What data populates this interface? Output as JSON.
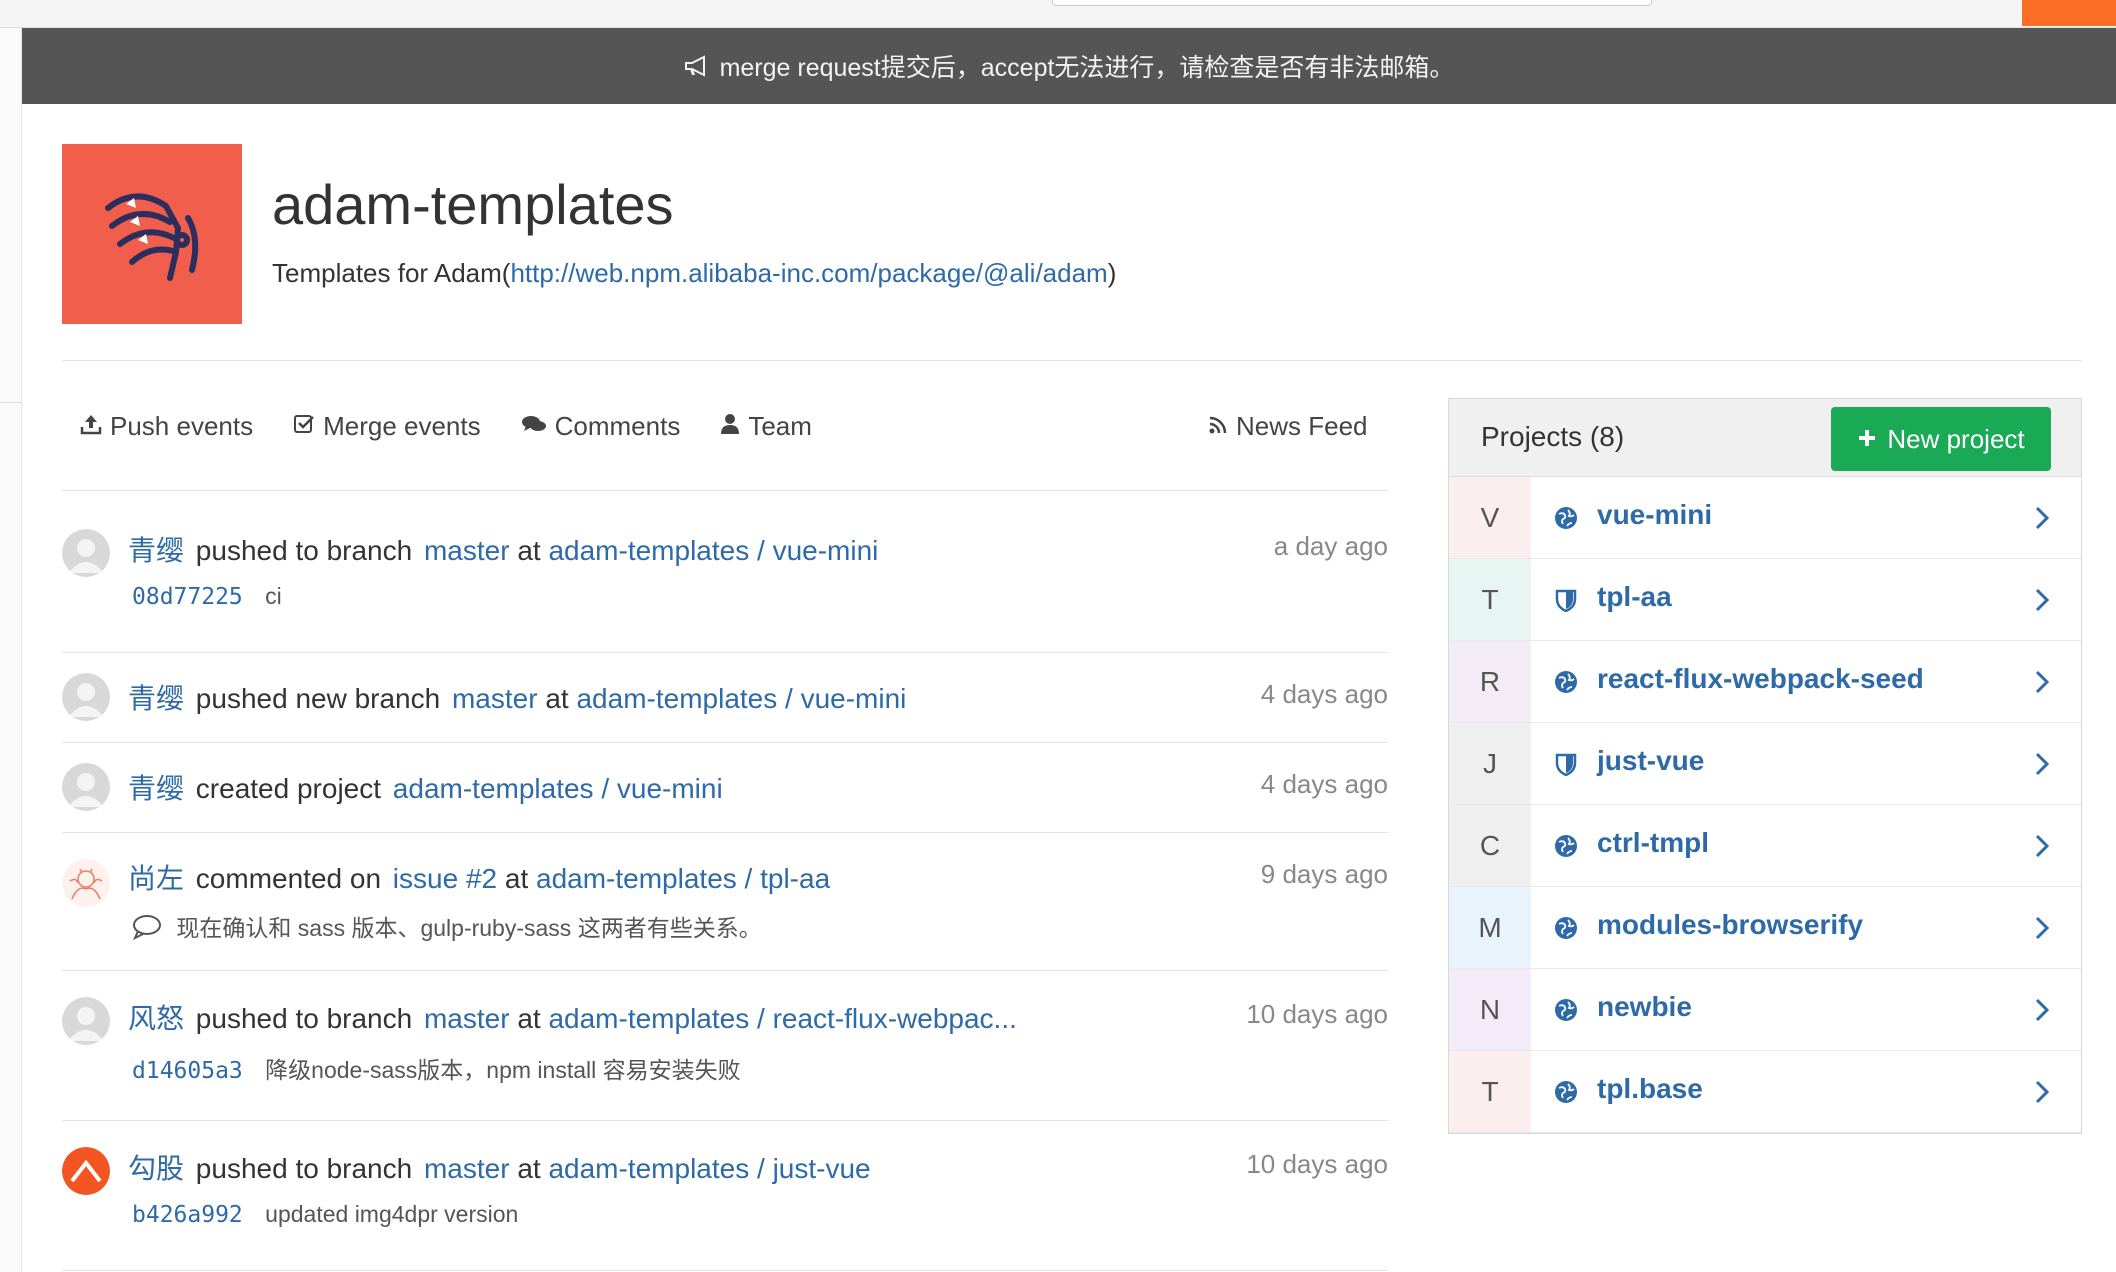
{
  "broadcast": {
    "icon": "bullhorn-icon",
    "text": "merge request提交后，accept无法进行，请检查是否有非法邮箱。"
  },
  "group": {
    "title": "adam-templates",
    "description_prefix": "Templates for Adam(",
    "description_link": "http://web.npm.alibaba-inc.com/package/@ali/adam",
    "description_suffix": ")",
    "avatar_color": "#f25e4c"
  },
  "filters": [
    {
      "label": "Push events",
      "icon": "upload-icon"
    },
    {
      "label": "Merge events",
      "icon": "check-square-icon"
    },
    {
      "label": "Comments",
      "icon": "comments-icon"
    },
    {
      "label": "Team",
      "icon": "user-icon"
    }
  ],
  "news_feed": {
    "label": "News Feed",
    "icon": "rss-icon"
  },
  "events": [
    {
      "author": "青缨",
      "action": "pushed to branch",
      "ref": "master",
      "at": "at",
      "project": "adam-templates / vue-mini",
      "time": "a day ago",
      "sha": "08d77225",
      "message": "ci"
    },
    {
      "author": "青缨",
      "action": "pushed new branch",
      "ref": "master",
      "at": "at",
      "project": "adam-templates / vue-mini",
      "time": "4 days ago"
    },
    {
      "author": "青缨",
      "action": "created project",
      "project": "adam-templates / vue-mini",
      "time": "4 days ago"
    },
    {
      "author": "尚左",
      "action": "commented on",
      "ref": "issue #2",
      "at": "at",
      "project": "adam-templates / tpl-aa",
      "time": "9 days ago",
      "comment": "现在确认和 sass 版本、gulp-ruby-sass 这两者有些关系。"
    },
    {
      "author": "风怒",
      "action": "pushed to branch",
      "ref": "master",
      "at": "at",
      "project": "adam-templates / react-flux-webpac...",
      "time": "10 days ago",
      "sha": "d14605a3",
      "message": "降级node-sass版本，npm install 容易安装失败"
    },
    {
      "author": "勾股",
      "action": "pushed to branch",
      "ref": "master",
      "at": "at",
      "project": "adam-templates / just-vue",
      "time": "10 days ago",
      "sha": "b426a992",
      "message": "updated img4dpr version"
    }
  ],
  "projects": {
    "title": "Projects (8)",
    "new_button": "New project",
    "items": [
      {
        "letter": "V",
        "name": "vue-mini",
        "visibility": "globe-icon",
        "bg": "#fbeeee"
      },
      {
        "letter": "T",
        "name": "tpl-aa",
        "visibility": "shield-icon",
        "bg": "#e8f6f3"
      },
      {
        "letter": "R",
        "name": "react-flux-webpack-seed",
        "visibility": "globe-icon",
        "bg": "#f3ecf7"
      },
      {
        "letter": "J",
        "name": "just-vue",
        "visibility": "shield-icon",
        "bg": "#efefef"
      },
      {
        "letter": "C",
        "name": "ctrl-tmpl",
        "visibility": "globe-icon",
        "bg": "#efefef"
      },
      {
        "letter": "M",
        "name": "modules-browserify",
        "visibility": "globe-icon",
        "bg": "#e9f3fb"
      },
      {
        "letter": "N",
        "name": "newbie",
        "visibility": "globe-icon",
        "bg": "#f3ecf8"
      },
      {
        "letter": "T",
        "name": "tpl.base",
        "visibility": "globe-icon",
        "bg": "#fbeeee"
      }
    ]
  }
}
